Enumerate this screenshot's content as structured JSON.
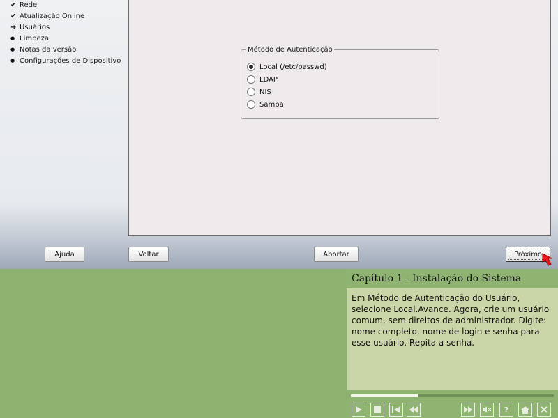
{
  "sidebar": {
    "items": [
      {
        "label": "Rede",
        "mark": "✔"
      },
      {
        "label": "Atualização Online",
        "mark": "✔"
      },
      {
        "label": "Usuários",
        "mark": "➜"
      },
      {
        "label": "Limpeza",
        "mark": "●"
      },
      {
        "label": "Notas da versão",
        "mark": "●"
      },
      {
        "label": "Configurações de Dispositivo",
        "mark": "●"
      }
    ]
  },
  "auth": {
    "legend": "Método de Autenticação",
    "options": [
      {
        "label": "Local (/etc/passwd)",
        "selected": true
      },
      {
        "label": "LDAP",
        "selected": false
      },
      {
        "label": "NIS",
        "selected": false
      },
      {
        "label": "Samba",
        "selected": false
      }
    ]
  },
  "buttons": {
    "help": "Ajuda",
    "back": "Voltar",
    "abort": "Abortar",
    "next": "Próximo"
  },
  "tutorial": {
    "title": "Capítulo 1 - Instalação do Sistema",
    "text": "Em Método de Autenticação do Usuário, selecione Local.Avance. Agora, crie um usuário comum, sem direitos de administrador. Digite: nome completo, nome de login e senha para esse usuário. Repita a senha.",
    "progress": 0.33
  },
  "controls": {
    "play": "play-icon",
    "stop": "stop-icon",
    "first": "first-icon",
    "prev": "prev-icon",
    "next": "next-icon",
    "mute": "mute-icon",
    "help": "help-icon",
    "home": "home-icon",
    "close": "close-icon"
  },
  "colors": {
    "tutorial_header": "#8fb370",
    "tutorial_body": "#cad6a8",
    "desktop_green": "#8db26f",
    "cursor": "#e8151b"
  }
}
